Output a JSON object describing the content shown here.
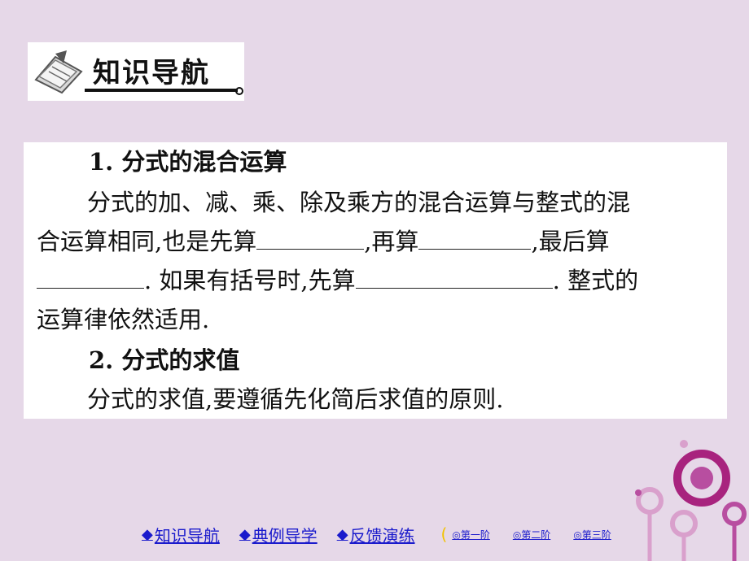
{
  "header": {
    "title": "知识导航"
  },
  "content": {
    "section1_title": "1. 分式的混合运算",
    "para1_line1": "分式的加、减、乘、除及乘方的混合运算与整式的混",
    "para1_line2a": "合运算相同,也是先算",
    "para1_line2b": ",再算",
    "para1_line2c": ",最后算",
    "para1_line3a": ". 如果有括号时,先算",
    "para1_line3b": ". 整式的",
    "para1_line4": "运算律依然适用.",
    "section2_title": "2. 分式的求值",
    "para2": "分式的求值,要遵循先化简后求值的原则."
  },
  "nav": {
    "items": [
      {
        "icon": "diamond-icon",
        "label": "知识导航"
      },
      {
        "icon": "diamond-icon",
        "label": "典例导学"
      },
      {
        "icon": "diamond-icon",
        "label": "反馈演练"
      }
    ],
    "stages": [
      "◎第一阶",
      "◎第二阶",
      "◎第三阶"
    ]
  },
  "colors": {
    "background": "#e6d8e8",
    "link": "#1a1acc",
    "accent": "#a8237e"
  }
}
